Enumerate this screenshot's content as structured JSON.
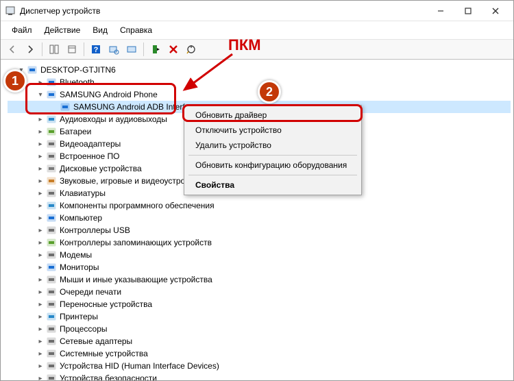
{
  "window": {
    "title": "Диспетчер устройств"
  },
  "menu": {
    "file": "Файл",
    "action": "Действие",
    "view": "Вид",
    "help": "Справка"
  },
  "root": "DESKTOP-GTJITN6",
  "annotations": {
    "pkm": "ПКМ",
    "step1": "1",
    "step2": "2"
  },
  "categories": [
    {
      "icon": "bluetooth",
      "label": "Bluetooth"
    },
    {
      "icon": "phone",
      "label": "SAMSUNG Android Phone",
      "child": {
        "icon": "phone",
        "label": "SAMSUNG Android ADB Interface"
      }
    },
    {
      "icon": "audio",
      "label": "Аудиовходы и аудиовыходы"
    },
    {
      "icon": "battery",
      "label": "Батареи"
    },
    {
      "icon": "video",
      "label": "Видеоадаптеры"
    },
    {
      "icon": "firmware",
      "label": "Встроенное ПО"
    },
    {
      "icon": "disk",
      "label": "Дисковые устройства"
    },
    {
      "icon": "sound",
      "label": "Звуковые, игровые и видеоустрой"
    },
    {
      "icon": "keyboard",
      "label": "Клавиатуры"
    },
    {
      "icon": "software",
      "label": "Компоненты программного обеспечения"
    },
    {
      "icon": "computer",
      "label": "Компьютер"
    },
    {
      "icon": "usb",
      "label": "Контроллеры USB"
    },
    {
      "icon": "storage",
      "label": "Контроллеры запоминающих устройств"
    },
    {
      "icon": "modem",
      "label": "Модемы"
    },
    {
      "icon": "monitor",
      "label": "Мониторы"
    },
    {
      "icon": "mouse",
      "label": "Мыши и иные указывающие устройства"
    },
    {
      "icon": "printqueue",
      "label": "Очереди печати"
    },
    {
      "icon": "portable",
      "label": "Переносные устройства"
    },
    {
      "icon": "printer",
      "label": "Принтеры"
    },
    {
      "icon": "cpu",
      "label": "Процессоры"
    },
    {
      "icon": "network",
      "label": "Сетевые адаптеры"
    },
    {
      "icon": "system",
      "label": "Системные устройства"
    },
    {
      "icon": "hid",
      "label": "Устройства HID (Human Interface Devices)"
    },
    {
      "icon": "security",
      "label": "Устройства безопасности"
    }
  ],
  "context_menu": [
    {
      "label": "Обновить драйвер",
      "hi": true
    },
    {
      "label": "Отключить устройство"
    },
    {
      "label": "Удалить устройство"
    },
    {
      "sep": true
    },
    {
      "label": "Обновить конфигурацию оборудования"
    },
    {
      "sep": true
    },
    {
      "label": "Свойства",
      "bold": true
    }
  ],
  "icon_colors": {
    "bluetooth": "#1a6fd4",
    "phone": "#1a6fd4",
    "audio": "#2889c9",
    "battery": "#5aa02c",
    "video": "#6d6d6d",
    "firmware": "#6d6d6d",
    "disk": "#7b7b7b",
    "sound": "#c97f28",
    "keyboard": "#6d6d6d",
    "software": "#2889c9",
    "computer": "#1a6fd4",
    "usb": "#6d6d6d",
    "storage": "#5aa02c",
    "modem": "#6d6d6d",
    "monitor": "#1a6fd4",
    "mouse": "#6d6d6d",
    "printqueue": "#6d6d6d",
    "portable": "#6d6d6d",
    "printer": "#2889c9",
    "cpu": "#6d6d6d",
    "network": "#6d6d6d",
    "system": "#6d6d6d",
    "hid": "#6d6d6d",
    "security": "#6d6d6d"
  }
}
